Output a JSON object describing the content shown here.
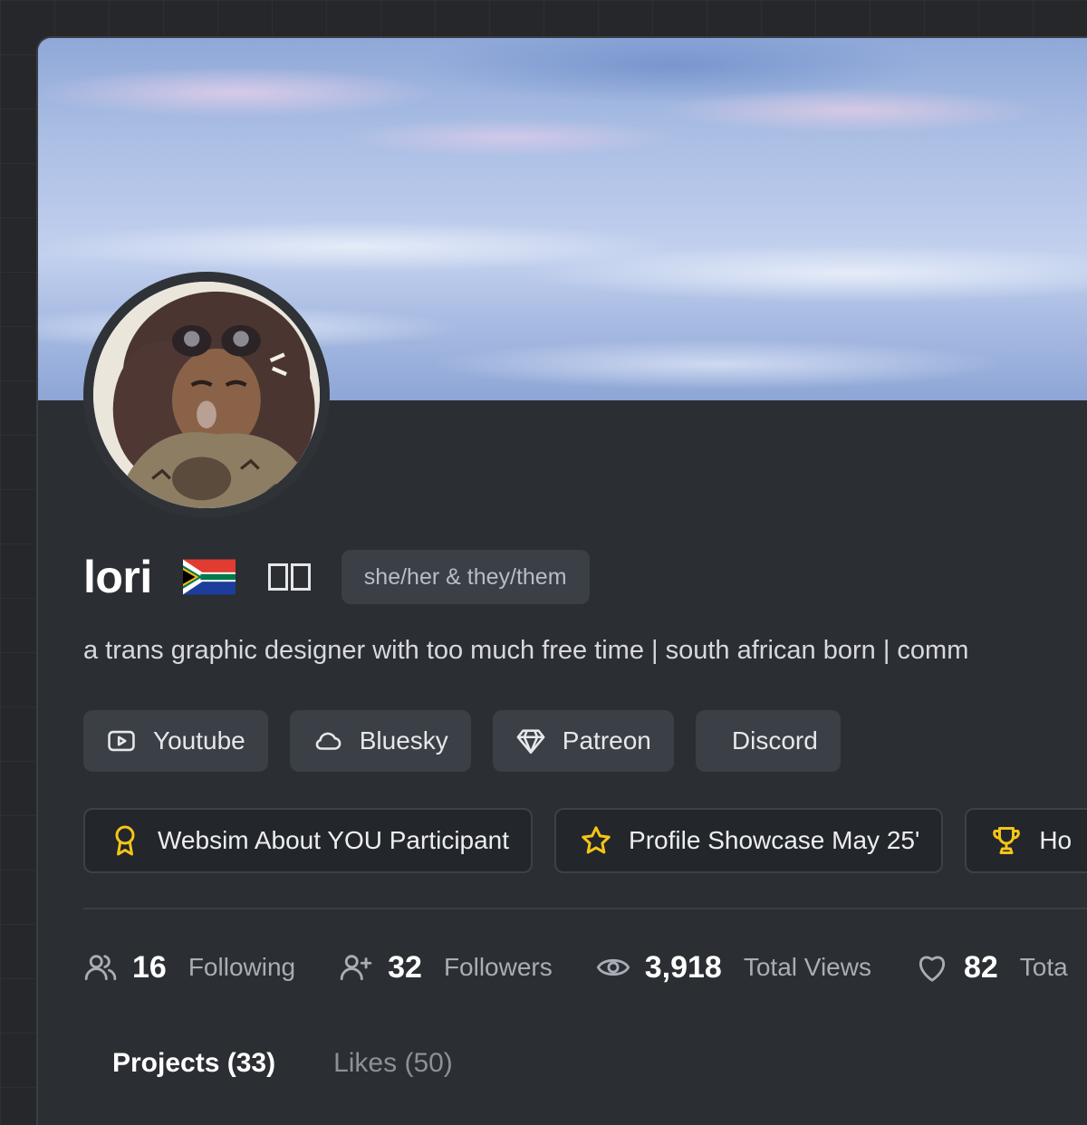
{
  "profile": {
    "name": "lori",
    "flag_icon": "south-africa-flag",
    "pronouns": "she/her & they/them",
    "bio": "a trans graphic designer with too much free time | south african born | comm"
  },
  "links": [
    {
      "label": "Youtube",
      "icon": "youtube-icon"
    },
    {
      "label": "Bluesky",
      "icon": "cloud-icon"
    },
    {
      "label": "Patreon",
      "icon": "diamond-icon"
    },
    {
      "label": "Discord",
      "icon": ""
    }
  ],
  "badges": [
    {
      "label": "Websim About YOU Participant",
      "icon": "award-ribbon-icon",
      "color": "#f5c518"
    },
    {
      "label": "Profile Showcase May 25'",
      "icon": "star-icon",
      "color": "#f5c518"
    },
    {
      "label": "Ho",
      "icon": "trophy-icon",
      "color": "#f5c518"
    }
  ],
  "stats": [
    {
      "value": "16",
      "label": "Following",
      "icon": "users-icon"
    },
    {
      "value": "32",
      "label": "Followers",
      "icon": "user-plus-icon"
    },
    {
      "value": "3,918",
      "label": "Total Views",
      "icon": "eye-icon"
    },
    {
      "value": "82",
      "label": "Tota",
      "icon": "heart-icon"
    }
  ],
  "tabs": [
    {
      "label": "Projects (33)",
      "active": true
    },
    {
      "label": "Likes (50)",
      "active": false
    }
  ],
  "colors": {
    "background": "#25272b",
    "card": "#2b2e33",
    "button": "#3b3f46",
    "badge_accent": "#f5c518"
  }
}
